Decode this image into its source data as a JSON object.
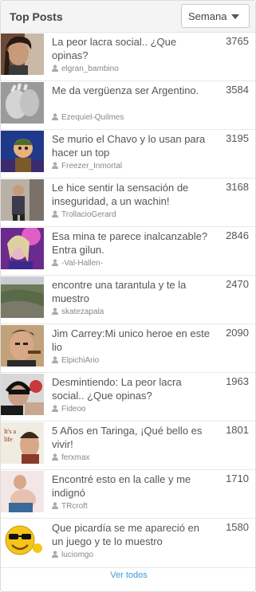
{
  "header": {
    "title": "Top Posts"
  },
  "period": {
    "selected": "Semana"
  },
  "posts": [
    {
      "title": "La peor lacra social.. ¿Que opinas?",
      "score": "3765",
      "author": "elgran_bambino",
      "thumb": "man-with-hair"
    },
    {
      "title": "Me da vergüenza ser Argentino.",
      "score": "3584",
      "author": "Ezequiel-Quilmes",
      "thumb": "hands-grey"
    },
    {
      "title": "Se murio el Chavo y lo usan para hacer un top",
      "score": "3195",
      "author": "Freezer_Inmortal",
      "thumb": "cartoon-character"
    },
    {
      "title": "Le hice sentir la sensación de inseguridad, a un wachin!",
      "score": "3168",
      "author": "TrollacioGerard",
      "thumb": "person-standing"
    },
    {
      "title": "Esa mina te parece inalcanzable? Entra gilun.",
      "score": "2846",
      "author": "-Val-Hallen-",
      "thumb": "woman-purple"
    },
    {
      "title": "encontre una tarantula y te la muestro",
      "score": "2470",
      "author": "skatezapala",
      "thumb": "aerial-landscape"
    },
    {
      "title": "Jim Carrey:Mi unico heroe en este lio",
      "score": "2090",
      "author": "ElpichiArio",
      "thumb": "man-with-cigar"
    },
    {
      "title": "Desmintiendo: La peor lacra social.. ¿Que opinas?",
      "score": "1963",
      "author": "Fideoo",
      "thumb": "man-headphones"
    },
    {
      "title": "5 Años en Taringa, ¡Qué bello es vivir!",
      "score": "1801",
      "author": "ferxmax",
      "thumb": "vintage-poster"
    },
    {
      "title": "Encontré esto en la calle y me indignó",
      "score": "1710",
      "author": "TRcroft",
      "thumb": "pregnant-woman"
    },
    {
      "title": "Que picardía se me apareció en un juego y te lo muestro",
      "score": "1580",
      "author": "luciomgo",
      "thumb": "smiley-sunglasses"
    }
  ],
  "footer": {
    "link": "Ver todos"
  },
  "colors": {
    "accent": "#3a9ad9",
    "text": "#555555",
    "muted": "#888888",
    "header_bg": "#f4f4f4"
  }
}
